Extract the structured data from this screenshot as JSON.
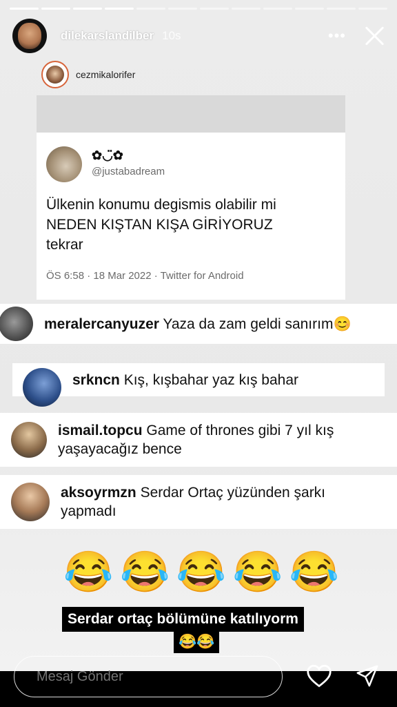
{
  "story": {
    "username": "dilekarslandilber",
    "time": "10s",
    "segments": 12,
    "active_segments": 4
  },
  "repost": {
    "username": "cezmikalorifer"
  },
  "tweet": {
    "name": "✿◡̈✿",
    "handle": "@justabadream",
    "text_lines": [
      "Ülkenin konumu degismis olabilir mi",
      "NEDEN KIŞTAN KIŞA GİRİYORUZ",
      "tekrar"
    ],
    "meta": "ÖS 6:58 · 18 Mar 2022 · Twitter for Android"
  },
  "comments": [
    {
      "user": "meralercanyuzer",
      "text": "Yaza da zam geldi sanırım😊"
    },
    {
      "user": "srkncn",
      "text": "Kış, kışbahar yaz kış bahar"
    },
    {
      "user": "ismail.topcu",
      "text": "Game of thrones gibi 7 yıl kış yaşayacağız bence"
    },
    {
      "user": "aksoyrmzn",
      "text": "Serdar Ortaç yüzünden şarkı yapmadı"
    }
  ],
  "emoji_row": "😂😂😂😂😂",
  "caption": {
    "line1": "Serdar ortaç bölümüne katılıyorm",
    "line2": "😂😂"
  },
  "reply": {
    "placeholder": "Mesaj Gönder"
  }
}
